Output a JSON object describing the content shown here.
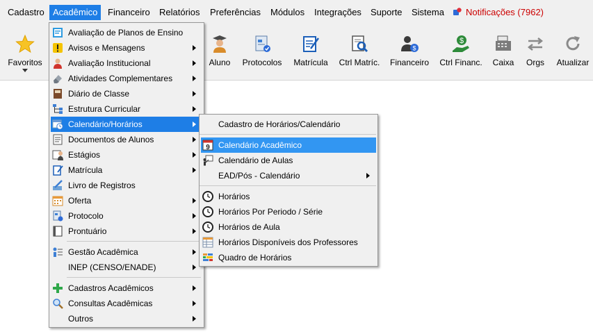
{
  "menubar": {
    "items": [
      {
        "label": "Cadastro"
      },
      {
        "label": "Acadêmico"
      },
      {
        "label": "Financeiro"
      },
      {
        "label": "Relatórios"
      },
      {
        "label": "Preferências"
      },
      {
        "label": "Módulos"
      },
      {
        "label": "Integrações"
      },
      {
        "label": "Suporte"
      },
      {
        "label": "Sistema"
      }
    ],
    "notifications_label": "Notificações (7962)",
    "notification_color": "#cc0000",
    "active_color": "#1e7ee6"
  },
  "toolbar": {
    "buttons": [
      {
        "label": "Favoritos",
        "icon": "star-icon"
      },
      {
        "label": "Aluno",
        "icon": "student-icon"
      },
      {
        "label": "Protocolos",
        "icon": "protocol-icon"
      },
      {
        "label": "Matrícula",
        "icon": "enrollment-icon"
      },
      {
        "label": "Ctrl Matríc.",
        "icon": "search-document-icon"
      },
      {
        "label": "Financeiro",
        "icon": "finance-user-icon"
      },
      {
        "label": "Ctrl Financ.",
        "icon": "money-hand-icon"
      },
      {
        "label": "Caixa",
        "icon": "cash-register-icon"
      },
      {
        "label": "Orgs",
        "icon": "arrows-icon"
      },
      {
        "label": "Atualizar",
        "icon": "refresh-icon"
      }
    ]
  },
  "academico_menu": {
    "items": [
      {
        "label": "Avaliação de Planos de Ensino",
        "icon": "plan-evaluation-icon",
        "submenu": false
      },
      {
        "label": "Avisos e Mensagens",
        "icon": "warning-icon",
        "submenu": true
      },
      {
        "label": "Avaliação Institucional",
        "icon": "person-icon",
        "submenu": true
      },
      {
        "label": "Atividades Complementares",
        "icon": "eraser-icon",
        "submenu": true
      },
      {
        "label": "Diário de Classe",
        "icon": "notebook-icon",
        "submenu": true
      },
      {
        "label": "Estrutura Curricular",
        "icon": "hierarchy-icon",
        "submenu": true
      },
      {
        "label": "Calendário/Horários",
        "icon": "calendar-clock-icon",
        "submenu": true
      },
      {
        "label": "Documentos de Alunos",
        "icon": "document-icon",
        "submenu": true
      },
      {
        "label": "Estágios",
        "icon": "internship-icon",
        "submenu": true
      },
      {
        "label": "Matrícula",
        "icon": "enrollment-icon",
        "submenu": true
      },
      {
        "label": "Livro de Registros",
        "icon": "pen-icon",
        "submenu": false
      },
      {
        "label": "Oferta",
        "icon": "calendar-grid-icon",
        "submenu": true
      },
      {
        "label": "Protocolo",
        "icon": "protocol-icon",
        "submenu": true
      },
      {
        "label": "Prontuário",
        "icon": "record-icon",
        "submenu": true
      },
      {
        "label": "Gestão Acadêmica",
        "icon": "org-chart-icon",
        "submenu": true
      },
      {
        "label": "INEP (CENSO/ENADE)",
        "icon": "",
        "submenu": true
      },
      {
        "label": "Cadastros Acadêmicos",
        "icon": "plus-icon",
        "submenu": true
      },
      {
        "label": "Consultas Acadêmicas",
        "icon": "magnifier-icon",
        "submenu": true
      },
      {
        "label": "Outros",
        "icon": "",
        "submenu": true
      }
    ]
  },
  "calendario_submenu": {
    "items": [
      {
        "label": "Cadastro de Horários/Calendário",
        "icon": ""
      },
      {
        "label": "Calendário Acadêmico",
        "icon": "calendar-9-icon"
      },
      {
        "label": "Calendário de Aulas",
        "icon": "teacher-board-icon"
      },
      {
        "label": "EAD/Pós - Calendário",
        "icon": ""
      },
      {
        "label": "Horários",
        "icon": "clock-icon"
      },
      {
        "label": "Horários Por Periodo / Série",
        "icon": "clock-icon"
      },
      {
        "label": "Horários de Aula",
        "icon": "clock-icon"
      },
      {
        "label": "Horários Disponíveis dos Professores",
        "icon": "table-icon"
      },
      {
        "label": "Quadro de Horários",
        "icon": "colored-grid-icon"
      }
    ]
  }
}
